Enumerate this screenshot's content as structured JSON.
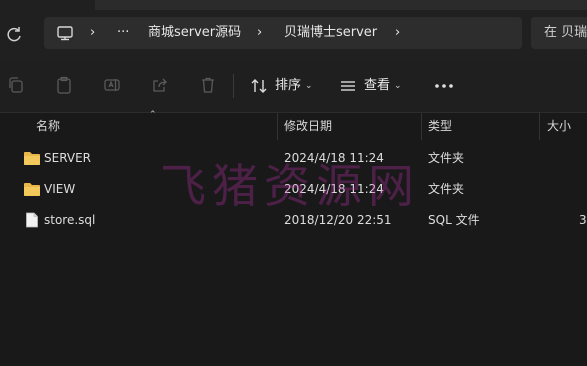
{
  "address": {
    "crumbs": [
      "商城server源码",
      "贝瑞博士server"
    ],
    "ellipsis": "···",
    "separator": "›",
    "search_placeholder": "在 贝瑞"
  },
  "toolbar": {
    "sort_label": "排序",
    "view_label": "查看",
    "chevron": "⌄"
  },
  "columns": {
    "name": "名称",
    "modified": "修改日期",
    "type": "类型",
    "size": "大小"
  },
  "files": [
    {
      "name": "SERVER",
      "modified": "2024/4/18 11:24",
      "type": "文件夹",
      "size": "",
      "icon": "folder-icon"
    },
    {
      "name": "VIEW",
      "modified": "2024/4/18 11:24",
      "type": "文件夹",
      "size": "",
      "icon": "folder-icon"
    },
    {
      "name": "store.sql",
      "modified": "2018/12/20 22:51",
      "type": "SQL 文件",
      "size": "3",
      "icon": "file-icon"
    }
  ],
  "watermark": "飞猪资源网",
  "colors": {
    "background": "#191919",
    "bar": "#202020",
    "folder": "#e8b84a",
    "watermark": "#be32aa"
  }
}
